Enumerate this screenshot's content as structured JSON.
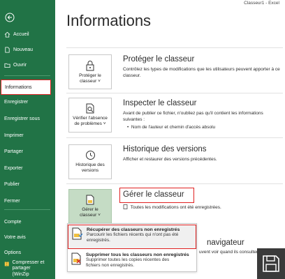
{
  "window": {
    "title": "Classeur1  -  Excel"
  },
  "page": {
    "title": "Informations"
  },
  "sidebar": {
    "items": [
      {
        "label": "Accueil"
      },
      {
        "label": "Nouveau"
      },
      {
        "label": "Ouvrir"
      },
      {
        "label": "Informations"
      },
      {
        "label": "Enregistrer"
      },
      {
        "label": "Enregistrer sous"
      },
      {
        "label": "Imprimer"
      },
      {
        "label": "Partager"
      },
      {
        "label": "Exporter"
      },
      {
        "label": "Publier"
      },
      {
        "label": "Fermer"
      },
      {
        "label": "Compte"
      },
      {
        "label": "Votre avis"
      },
      {
        "label": "Options"
      },
      {
        "label": "Compresser et partager"
      },
      {
        "label": "(WinZip"
      }
    ]
  },
  "sections": {
    "protect": {
      "button_line1": "Protéger le",
      "button_line2": "classeur ˅",
      "title": "Protéger le classeur",
      "desc_line1": "Contrôlez les types de modifications que les utilisateurs peuvent apporter à ce",
      "desc_line2": "classeur."
    },
    "inspect": {
      "button_line1": "Vérifier l'absence",
      "button_line2": "de problèmes ˅",
      "title": "Inspecter le classeur",
      "desc_line1": "Avant de publier ce fichier, n'oubliez pas qu'il contient les informations",
      "desc_line2": "suivantes :",
      "bullet": "Nom de l'auteur et chemin d'accès absolu"
    },
    "history": {
      "button_line1": "Historique des",
      "button_line2": "versions",
      "title": "Historique des versions",
      "desc": "Afficher et restaurer des versions précédentes."
    },
    "manage": {
      "button_line1": "Gérer le",
      "button_line2": "classeur ˅",
      "title": "Gérer le classeur",
      "desc": "Toutes les modifications ont été enregistrées."
    },
    "browser": {
      "title_partial": "navigateur",
      "desc_partial": "uvent voir quand ils consultent"
    }
  },
  "menu": {
    "recover": {
      "title": "Récupérer des classeurs non enregistrés",
      "desc_line1": "Parcourir les fichiers récents qui n'ont pas été",
      "desc_line2": "enregistrés."
    },
    "delete": {
      "title": "Supprimer tous les classeurs non enregistrés",
      "desc_line1": "Supprimer toutes les copies récentes des",
      "desc_line2": "fichiers non enregistrés."
    }
  },
  "colors": {
    "sidebar": "#217346",
    "highlight_border": "#e02020",
    "button_green": "#c5dcc5"
  }
}
